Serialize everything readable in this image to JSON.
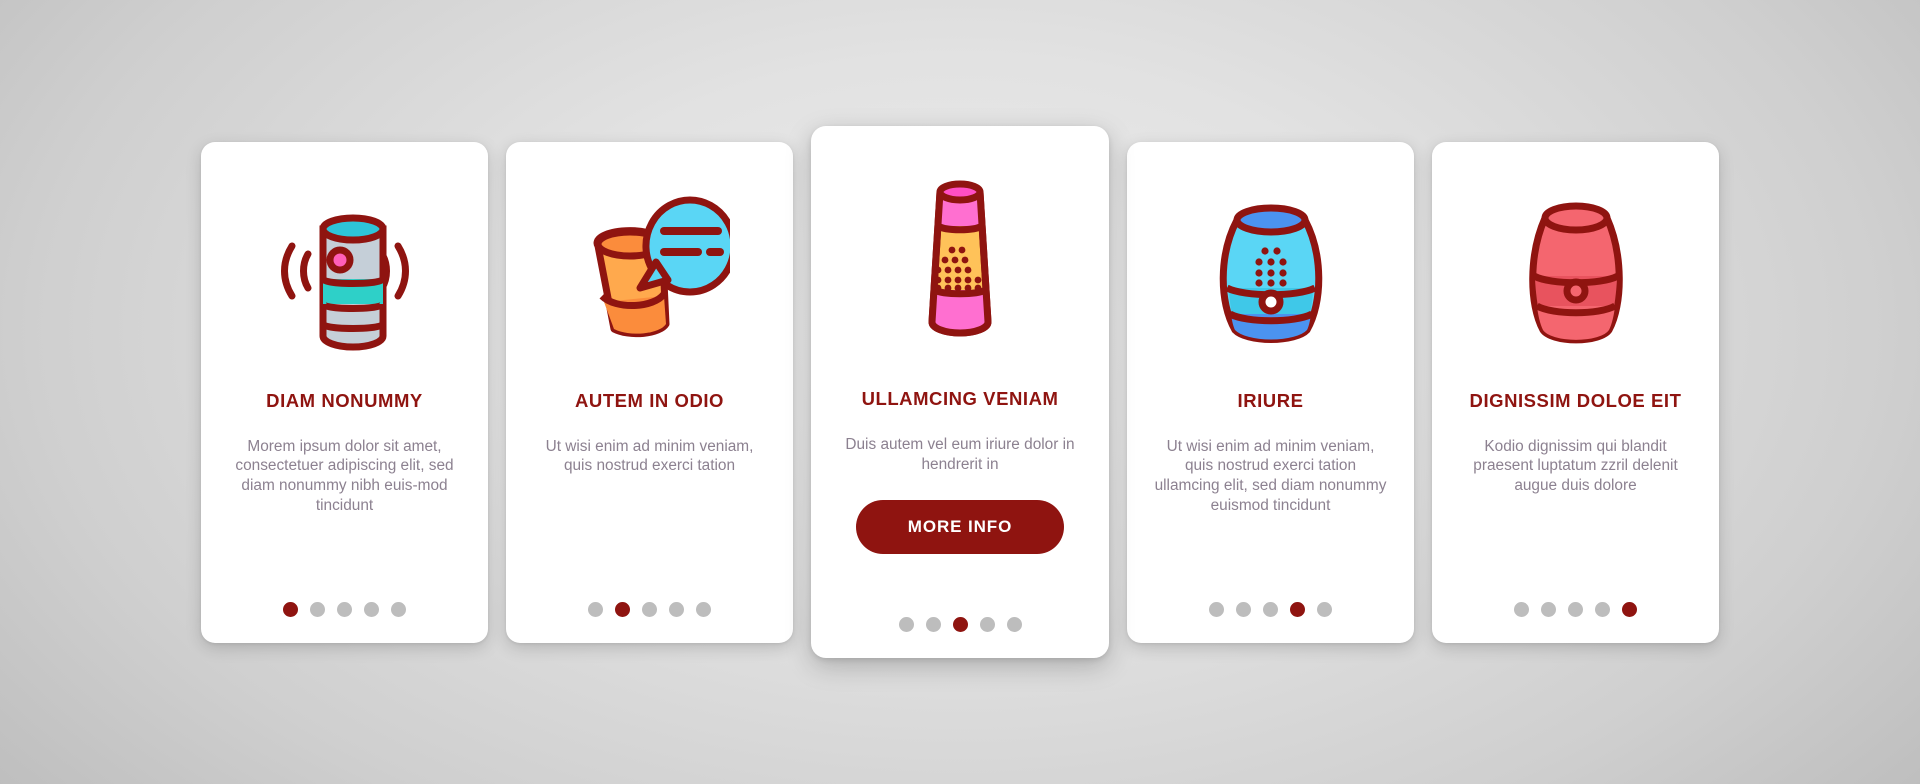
{
  "theme": {
    "accent": "#8f1410",
    "body_text": "#8c8190",
    "card_bg": "#ffffff",
    "dot_inactive": "#bdbdbd",
    "dot_active": "#8f1410",
    "page_bg": "#cfcfcf"
  },
  "cards": [
    {
      "id": "card-diam-nonummy",
      "icon_name": "smart-speaker-cylinder-soundwaves-icon",
      "title": "DIAM NONUMMY",
      "body": "Morem ipsum dolor sit amet, consectetuer adipiscing elit, sed diam nonummy nibh euis-mod tincidunt",
      "featured": false,
      "button": null,
      "dots": {
        "count": 5,
        "active_index": 0
      }
    },
    {
      "id": "card-autem-in-odio",
      "icon_name": "smart-speaker-speech-bubble-icon",
      "title": "AUTEM IN ODIO",
      "body": "Ut wisi enim ad minim veniam, quis nostrud exerci tation",
      "featured": false,
      "button": null,
      "dots": {
        "count": 5,
        "active_index": 1
      }
    },
    {
      "id": "card-ullamcing-veniam",
      "icon_name": "smart-speaker-tapered-dotgrid-icon",
      "title": "ULLAMCING VENIAM",
      "body": "Duis autem vel eum iriure dolor in hendrerit in",
      "featured": true,
      "button": {
        "label": "MORE INFO",
        "name": "more-info-button"
      },
      "dots": {
        "count": 5,
        "active_index": 2
      }
    },
    {
      "id": "card-iriure",
      "icon_name": "smart-speaker-barrel-blue-icon",
      "title": "IRIURE",
      "body": "Ut wisi enim ad minim veniam, quis nostrud exerci tation ullamcing elit, sed diam nonummy euismod tincidunt",
      "featured": false,
      "button": null,
      "dots": {
        "count": 5,
        "active_index": 3
      }
    },
    {
      "id": "card-dignissim-doloe-eit",
      "icon_name": "smart-speaker-barrel-red-icon",
      "title": "DIGNISSIM DOLOE EIT",
      "body": "Kodio dignissim qui blandit praesent luptatum zzril delenit augue duis dolore",
      "featured": false,
      "button": null,
      "dots": {
        "count": 5,
        "active_index": 4
      }
    }
  ]
}
